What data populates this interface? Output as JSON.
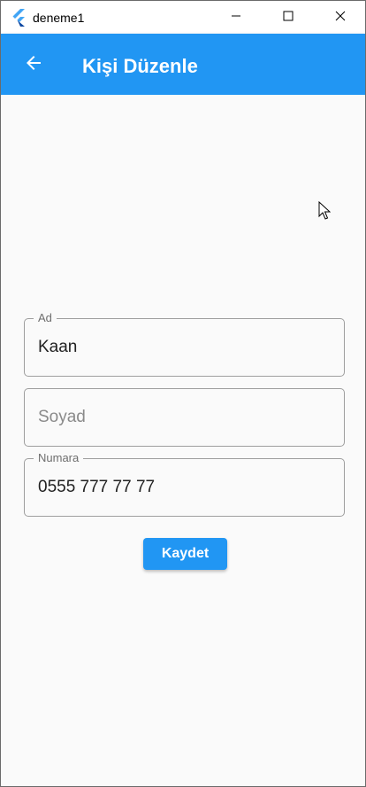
{
  "window": {
    "title": "deneme1",
    "icons": {
      "app": "flutter-logo-icon",
      "minimize": "minimize-icon",
      "maximize": "maximize-icon",
      "close": "close-icon"
    }
  },
  "appbar": {
    "title": "Kişi Düzenle",
    "back_icon": "arrow-back-icon",
    "color": "#2196f3"
  },
  "form": {
    "ad": {
      "label": "Ad",
      "value": "Kaan"
    },
    "soyad": {
      "placeholder": "Soyad",
      "value": ""
    },
    "numara": {
      "label": "Numara",
      "value": "0555 777 77 77"
    }
  },
  "actions": {
    "save_label": "Kaydet"
  }
}
